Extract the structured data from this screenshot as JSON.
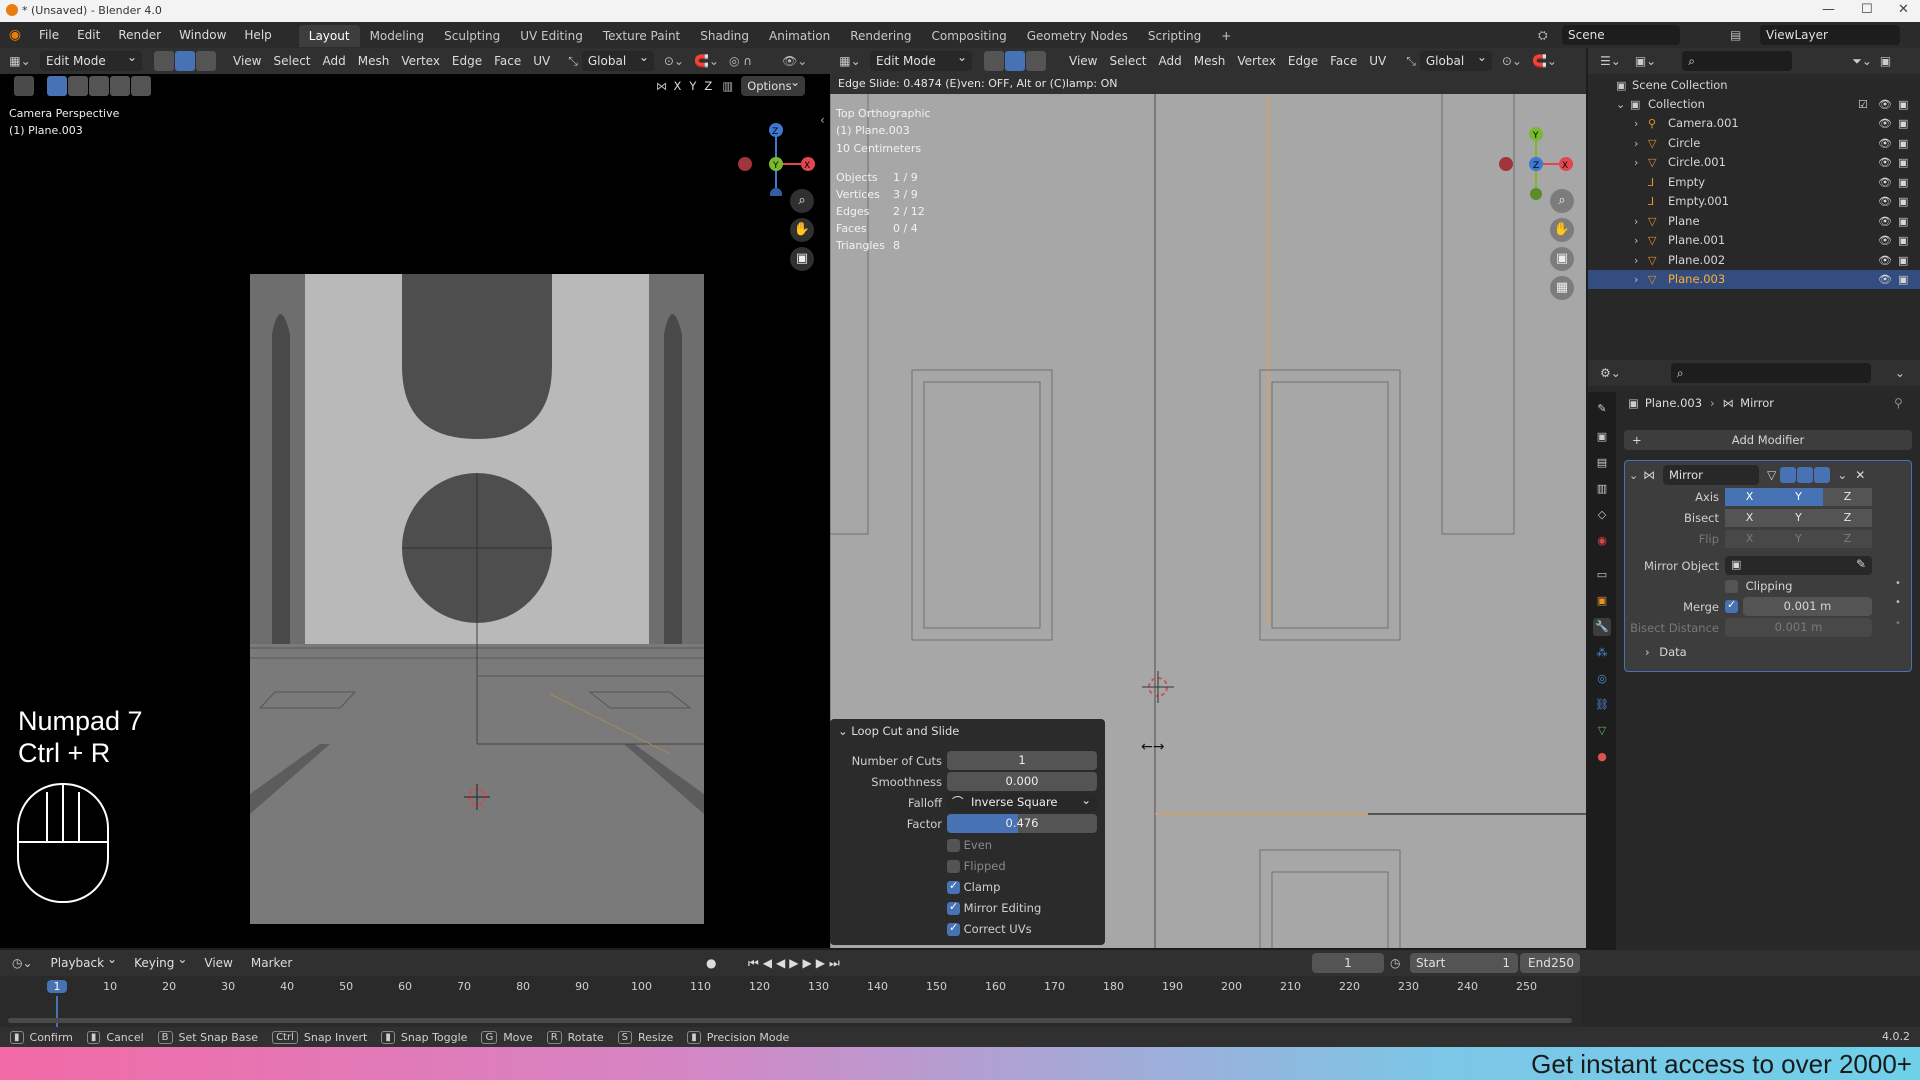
{
  "window": {
    "title": "* (Unsaved) - Blender 4.0",
    "controls": [
      "—",
      "☐",
      "✕"
    ]
  },
  "menu": [
    "File",
    "Edit",
    "Render",
    "Window",
    "Help"
  ],
  "workspaces": [
    "Layout",
    "Modeling",
    "Sculpting",
    "UV Editing",
    "Texture Paint",
    "Shading",
    "Animation",
    "Rendering",
    "Compositing",
    "Geometry Nodes",
    "Scripting",
    "+"
  ],
  "scene": {
    "label": "Scene",
    "view_layer": "ViewLayer"
  },
  "viewport_left": {
    "mode": "Edit Mode",
    "menus": [
      "View",
      "Select",
      "Add",
      "Mesh",
      "Vertex",
      "Edge",
      "Face",
      "UV"
    ],
    "transform": "Global",
    "axes": [
      "X",
      "Y",
      "Z"
    ],
    "options": "Options",
    "overlay_title": "Camera Perspective",
    "overlay_object": "(1) Plane.003",
    "shortcut_line1": "Numpad 7",
    "shortcut_line2": "Ctrl + R",
    "gizmo_icons": [
      "zoom-icon",
      "hand-icon",
      "camera-icon"
    ]
  },
  "viewport_right": {
    "mode": "Edit Mode",
    "menus": [
      "View",
      "Select",
      "Add",
      "Mesh",
      "Vertex",
      "Edge",
      "Face",
      "UV"
    ],
    "transform": "Global",
    "status_header": "Edge Slide: 0.4874 (E)ven: OFF, Alt or (C)lamp: ON",
    "view_name": "Top Orthographic",
    "object": "(1) Plane.003",
    "scale": "10 Centimeters",
    "stats": [
      {
        "label": "Objects",
        "value": "1 / 9"
      },
      {
        "label": "Vertices",
        "value": "3 / 9"
      },
      {
        "label": "Edges",
        "value": "2 / 12"
      },
      {
        "label": "Faces",
        "value": "0 / 4"
      },
      {
        "label": "Triangles",
        "value": "8"
      }
    ]
  },
  "operator_panel": {
    "title": "Loop Cut and Slide",
    "fields": [
      {
        "label": "Number of Cuts",
        "value": "1"
      },
      {
        "label": "Smoothness",
        "value": "0.000"
      },
      {
        "label": "Falloff",
        "value": "Inverse Square"
      },
      {
        "label": "Factor",
        "value": "0.476"
      }
    ],
    "factor_fraction": 0.476,
    "checkboxes": [
      {
        "label": "Even",
        "checked": false
      },
      {
        "label": "Flipped",
        "checked": false
      },
      {
        "label": "Clamp",
        "checked": true
      },
      {
        "label": "Mirror Editing",
        "checked": true
      },
      {
        "label": "Correct UVs",
        "checked": true
      }
    ]
  },
  "outliner": {
    "root": "Scene Collection",
    "collection": "Collection",
    "items": [
      {
        "name": "Camera.001",
        "type": "camera",
        "selected": false
      },
      {
        "name": "Circle",
        "type": "mesh",
        "selected": false
      },
      {
        "name": "Circle.001",
        "type": "mesh",
        "selected": false
      },
      {
        "name": "Empty",
        "type": "empty",
        "selected": false
      },
      {
        "name": "Empty.001",
        "type": "empty",
        "selected": false
      },
      {
        "name": "Plane",
        "type": "mesh",
        "selected": false
      },
      {
        "name": "Plane.001",
        "type": "mesh",
        "selected": false
      },
      {
        "name": "Plane.002",
        "type": "mesh",
        "selected": false
      },
      {
        "name": "Plane.003",
        "type": "mesh",
        "selected": true
      }
    ]
  },
  "properties": {
    "breadcrumb_object": "Plane.003",
    "breadcrumb_modifier": "Mirror",
    "add_modifier": "Add Modifier",
    "modifier_name": "Mirror",
    "axis_label": "Axis",
    "bisect_label": "Bisect",
    "flip_label": "Flip",
    "axes": [
      "X",
      "Y",
      "Z"
    ],
    "axis_on": [
      true,
      true,
      false
    ],
    "mirror_object_label": "Mirror Object",
    "clipping_label": "Clipping",
    "merge_label": "Merge",
    "merge_value": "0.001 m",
    "bisect_distance_label": "Bisect Distance",
    "bisect_distance_value": "0.001 m",
    "data_label": "Data"
  },
  "timeline": {
    "menus": [
      "Playback",
      "Keying",
      "View",
      "Marker"
    ],
    "current_frame": "1",
    "start_label": "Start",
    "start": "1",
    "end_label": "End",
    "end": "250",
    "ticks": [
      "1",
      "10",
      "20",
      "30",
      "40",
      "50",
      "60",
      "70",
      "80",
      "90",
      "100",
      "110",
      "120",
      "130",
      "140",
      "150",
      "160",
      "170",
      "180",
      "190",
      "200",
      "210",
      "220",
      "230",
      "240",
      "250"
    ]
  },
  "statusbar": {
    "items": [
      {
        "key": "",
        "label": "Confirm"
      },
      {
        "key": "",
        "label": "Cancel"
      },
      {
        "key": "B",
        "label": "Set Snap Base"
      },
      {
        "key": "Ctrl",
        "label": "Snap Invert"
      },
      {
        "key": "",
        "label": "Snap Toggle"
      },
      {
        "key": "G",
        "label": "Move"
      },
      {
        "key": "R",
        "label": "Rotate"
      },
      {
        "key": "S",
        "label": "Resize"
      },
      {
        "key": "",
        "label": "Precision Mode"
      }
    ],
    "version": "4.0.2"
  },
  "banner": {
    "text": "Get instant access to over 2000+"
  },
  "colors": {
    "accent": "#4772b3",
    "selected_text": "#ffaf29",
    "axis_x": "#e0474f",
    "axis_y": "#7cb82f",
    "axis_z": "#3f78d1"
  }
}
